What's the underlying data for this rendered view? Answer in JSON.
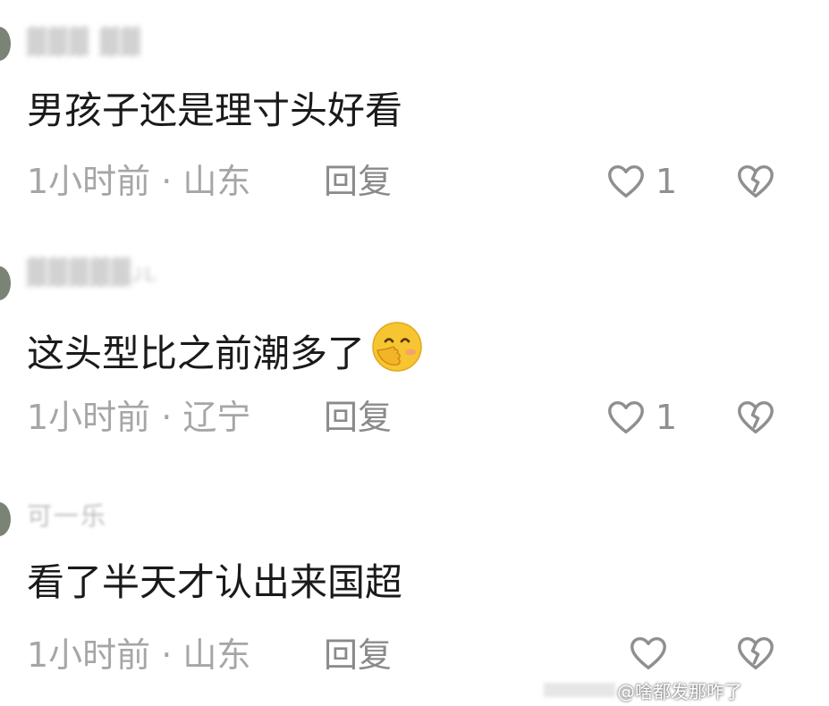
{
  "comments": [
    {
      "username": "▓▓▓ ▓▓",
      "text": "男孩子还是理寸头好看",
      "meta": "1小时前 · 山东",
      "reply": "回复",
      "likes": "1"
    },
    {
      "username": "▓▓▓▓▓ᴊʟ",
      "text": "这头型比之前潮多了",
      "meta": "1小时前 · 辽宁",
      "reply": "回复",
      "likes": "1"
    },
    {
      "username": "可一乐",
      "text": "看了半天才认出来国超",
      "meta": "1小时前 · 山东",
      "reply": "回复",
      "likes": ""
    }
  ],
  "icons": {
    "like": "heart-outline-icon",
    "dislike": "broken-heart-icon",
    "emoji": "face-with-hand-over-mouth-emoji"
  },
  "watermark": "@啥都发那咋了"
}
